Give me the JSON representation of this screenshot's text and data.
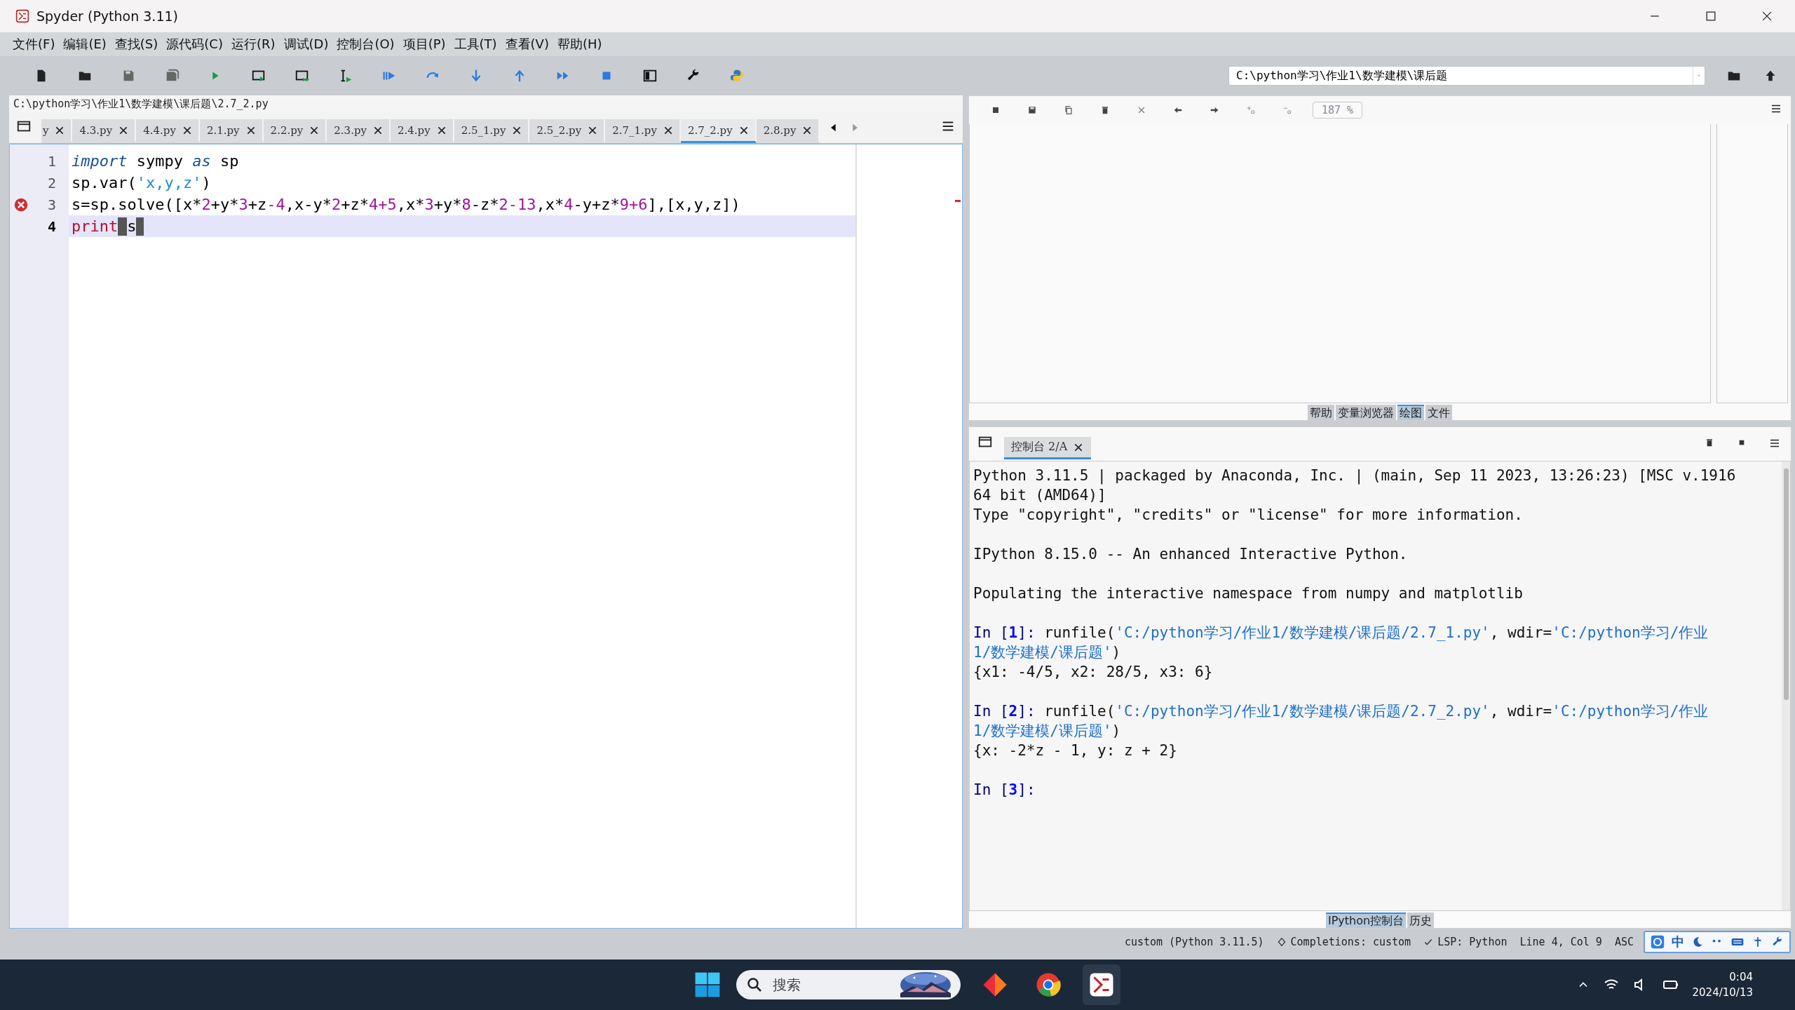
{
  "window": {
    "title": "Spyder (Python 3.11)"
  },
  "menu": [
    "文件(F)",
    "编辑(E)",
    "查找(S)",
    "源代码(C)",
    "运行(R)",
    "调试(D)",
    "控制台(O)",
    "项目(P)",
    "工具(T)",
    "查看(V)",
    "帮助(H)"
  ],
  "working_directory": {
    "value": "C:\\python学习\\作业1\\数学建模\\课后题"
  },
  "editor": {
    "path": "C:\\python学习\\作业1\\数学建模\\课后题\\2.7_2.py",
    "tabs": [
      {
        "label": "y",
        "selected": false
      },
      {
        "label": "4.3.py",
        "selected": false
      },
      {
        "label": "4.4.py",
        "selected": false
      },
      {
        "label": "2.1.py",
        "selected": false
      },
      {
        "label": "2.2.py",
        "selected": false
      },
      {
        "label": "2.3.py",
        "selected": false
      },
      {
        "label": "2.4.py",
        "selected": false
      },
      {
        "label": "2.5_1.py",
        "selected": false
      },
      {
        "label": "2.5_2.py",
        "selected": false
      },
      {
        "label": "2.7_1.py",
        "selected": false
      },
      {
        "label": "2.7_2.py",
        "selected": true
      },
      {
        "label": "2.8.py",
        "selected": false
      }
    ],
    "lines": [
      {
        "number": "1",
        "error": false,
        "current": false,
        "tokens": [
          {
            "text": "import",
            "kind": "keyword"
          },
          {
            "text": " sympy ",
            "kind": "plain"
          },
          {
            "text": "as",
            "kind": "keyword"
          },
          {
            "text": " sp",
            "kind": "plain"
          }
        ]
      },
      {
        "number": "2",
        "error": false,
        "current": false,
        "tokens": [
          {
            "text": "sp.var(",
            "kind": "plain"
          },
          {
            "text": "'x,y,z'",
            "kind": "string"
          },
          {
            "text": ")",
            "kind": "plain"
          }
        ]
      },
      {
        "number": "3",
        "error": true,
        "current": false,
        "tokens": [
          {
            "text": "s=sp.solve([x*",
            "kind": "plain"
          },
          {
            "text": "2",
            "kind": "number"
          },
          {
            "text": "+y*",
            "kind": "plain"
          },
          {
            "text": "3",
            "kind": "number"
          },
          {
            "text": "+z",
            "kind": "plain"
          },
          {
            "text": "-4",
            "kind": "number"
          },
          {
            "text": ",x-y*",
            "kind": "plain"
          },
          {
            "text": "2",
            "kind": "number"
          },
          {
            "text": "+z*",
            "kind": "plain"
          },
          {
            "text": "4+5",
            "kind": "number"
          },
          {
            "text": ",x*",
            "kind": "plain"
          },
          {
            "text": "3",
            "kind": "number"
          },
          {
            "text": "+y*",
            "kind": "plain"
          },
          {
            "text": "8",
            "kind": "number"
          },
          {
            "text": "-z*",
            "kind": "plain"
          },
          {
            "text": "2-13",
            "kind": "number"
          },
          {
            "text": ",x*",
            "kind": "plain"
          },
          {
            "text": "4",
            "kind": "number"
          },
          {
            "text": "-y+z*",
            "kind": "plain"
          },
          {
            "text": "9+6",
            "kind": "number"
          },
          {
            "text": "],[x,y,z])",
            "kind": "plain"
          }
        ]
      },
      {
        "number": "4",
        "error": false,
        "current": true,
        "tokens": [
          {
            "text": "print",
            "kind": "builtin"
          },
          {
            "text": "s",
            "kind": "plain",
            "marked_before": true
          }
        ]
      }
    ]
  },
  "plots_pane": {
    "zoom": "187 %",
    "tabs": [
      {
        "label": "帮助",
        "selected": false
      },
      {
        "label": "变量浏览器",
        "selected": false
      },
      {
        "label": "绘图",
        "selected": true
      },
      {
        "label": "文件",
        "selected": false
      }
    ]
  },
  "console_pane": {
    "tab": "控制台 2/A",
    "lines": [
      {
        "kind": "text",
        "segments": [
          {
            "text": "Python 3.11.5 | packaged by Anaconda, Inc. | (main, Sep 11 2023, 13:26:23) [MSC v.1916",
            "kind": "text"
          }
        ]
      },
      {
        "kind": "text",
        "segments": [
          {
            "text": "64 bit (AMD64)]",
            "kind": "text"
          }
        ]
      },
      {
        "kind": "text",
        "segments": [
          {
            "text": "Type \"copyright\", \"credits\" or \"license\" for more information.",
            "kind": "text"
          }
        ]
      },
      {
        "kind": "blank"
      },
      {
        "kind": "text",
        "segments": [
          {
            "text": "IPython 8.15.0 -- An enhanced Interactive Python.",
            "kind": "text"
          }
        ]
      },
      {
        "kind": "blank"
      },
      {
        "kind": "text",
        "segments": [
          {
            "text": "Populating the interactive namespace from numpy and matplotlib",
            "kind": "text"
          }
        ]
      },
      {
        "kind": "blank"
      },
      {
        "kind": "text",
        "segments": [
          {
            "text": "In [",
            "kind": "prompt"
          },
          {
            "text": "1",
            "kind": "prompt_number"
          },
          {
            "text": "]: ",
            "kind": "prompt"
          },
          {
            "text": "runfile(",
            "kind": "text"
          },
          {
            "text": "'C:/python学习/作业1/数学建模/课后题/2.7_1.py'",
            "kind": "string"
          },
          {
            "text": ", wdir=",
            "kind": "text"
          },
          {
            "text": "'C:/python学习/作业",
            "kind": "string"
          }
        ]
      },
      {
        "kind": "text",
        "segments": [
          {
            "text": "1/数学建模/课后题'",
            "kind": "string"
          },
          {
            "text": ")",
            "kind": "text"
          }
        ]
      },
      {
        "kind": "text",
        "segments": [
          {
            "text": "{x1: -4/5, x2: 28/5, x3: 6}",
            "kind": "text"
          }
        ]
      },
      {
        "kind": "blank"
      },
      {
        "kind": "text",
        "segments": [
          {
            "text": "In [",
            "kind": "prompt"
          },
          {
            "text": "2",
            "kind": "prompt_number"
          },
          {
            "text": "]: ",
            "kind": "prompt"
          },
          {
            "text": "runfile(",
            "kind": "text"
          },
          {
            "text": "'C:/python学习/作业1/数学建模/课后题/2.7_2.py'",
            "kind": "string"
          },
          {
            "text": ", wdir=",
            "kind": "text"
          },
          {
            "text": "'C:/python学习/作业",
            "kind": "string"
          }
        ]
      },
      {
        "kind": "text",
        "segments": [
          {
            "text": "1/数学建模/课后题'",
            "kind": "string"
          },
          {
            "text": ")",
            "kind": "text"
          }
        ]
      },
      {
        "kind": "text",
        "segments": [
          {
            "text": "{x: -2*z - 1, y: z + 2}",
            "kind": "text"
          }
        ]
      },
      {
        "kind": "blank"
      },
      {
        "kind": "text",
        "segments": [
          {
            "text": "In [",
            "kind": "prompt"
          },
          {
            "text": "3",
            "kind": "prompt_number"
          },
          {
            "text": "]:",
            "kind": "prompt"
          }
        ]
      }
    ],
    "tabs": [
      {
        "label": "IPython控制台",
        "selected": true
      },
      {
        "label": "历史",
        "selected": false
      }
    ]
  },
  "status_bar": [
    {
      "text": "custom (Python 3.11.5)",
      "kind": "plain"
    },
    {
      "text": "Completions: custom",
      "kind": "completions"
    },
    {
      "text": "LSP: Python",
      "kind": "check"
    },
    {
      "text": "Line 4, Col 9",
      "kind": "plain"
    },
    {
      "text": "ASC",
      "kind": "plain"
    }
  ],
  "ime": {
    "mode": "中"
  },
  "taskbar": {
    "search": {
      "placeholder": "搜索"
    },
    "time": "0:04",
    "date": "2024/10/13"
  }
}
